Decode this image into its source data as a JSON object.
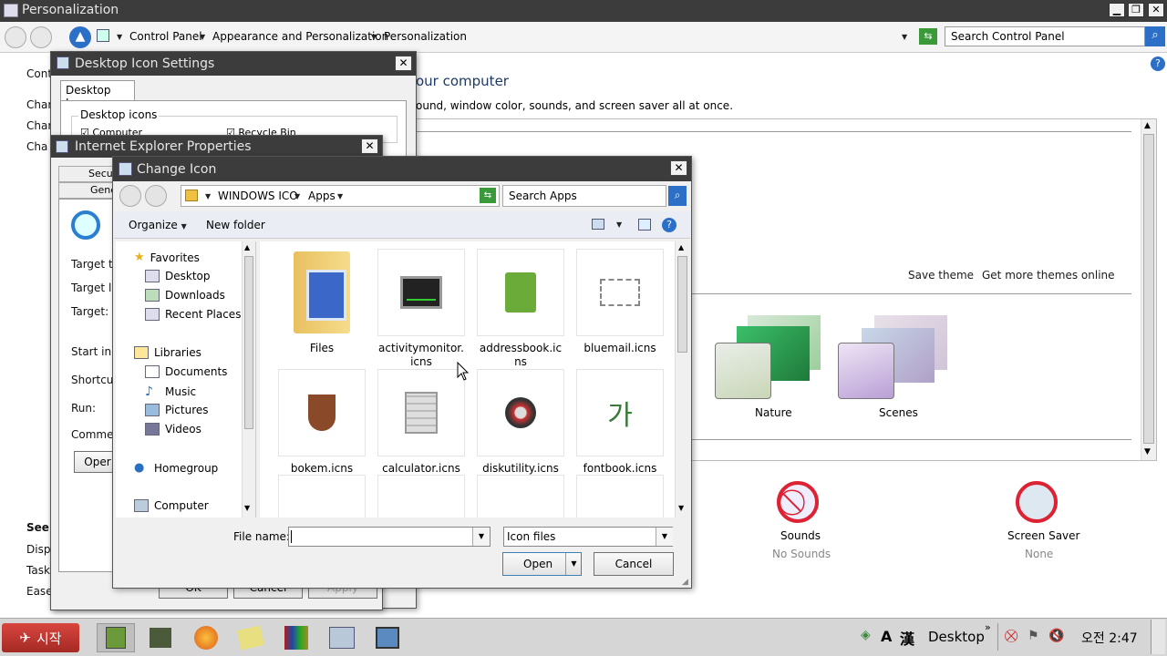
{
  "window": {
    "title": "Personalization",
    "minimize": "▁",
    "maximize": "❐",
    "close": "✕"
  },
  "addressbar": {
    "crumbs": [
      "Control Panel",
      "Appearance and Personalization",
      "Personalization"
    ],
    "search_placeholder": "Search Control Panel"
  },
  "sidebar": {
    "cont": "Cont",
    "items": [
      "Char",
      "Char",
      "Cha"
    ],
    "see_also": "See",
    "see_items": [
      "Disp",
      "Task",
      "Ease"
    ]
  },
  "main": {
    "heading": "our computer",
    "desc": "ound, window color, sounds, and screen saver all at once.",
    "save_theme": "Save theme",
    "get_more": "Get more themes online",
    "themes": [
      {
        "label": "Nature"
      },
      {
        "label": "Scenes"
      }
    ],
    "bottom": [
      {
        "label": "Sounds",
        "sub": "No Sounds"
      },
      {
        "label": "Screen Saver",
        "sub": "None"
      }
    ]
  },
  "desktop_icon_settings": {
    "title": "Desktop Icon Settings",
    "tab": "Desktop Icons",
    "group": "Desktop icons",
    "cb1": "Computer",
    "cb2": "Recycle Bin",
    "ok": "OK",
    "cancel": "Cancel",
    "apply": "Apply"
  },
  "ie_props": {
    "title": "Internet Explorer Properties",
    "tabs": [
      "Secur",
      "Gene"
    ],
    "fields": [
      "Target ty",
      "Target lc",
      "Target:",
      "Start in:",
      "Shortcut",
      "Run:",
      "Commer"
    ],
    "open_btn": "Oper"
  },
  "change_icon": {
    "title": "Change Icon",
    "path": [
      "WINDOWS ICO",
      "Apps"
    ],
    "search_placeholder": "Search Apps",
    "organize": "Organize",
    "new_folder": "New folder",
    "nav": {
      "favorites": "Favorites",
      "fav_items": [
        "Desktop",
        "Downloads",
        "Recent Places"
      ],
      "libraries": "Libraries",
      "lib_items": [
        "Documents",
        "Music",
        "Pictures",
        "Videos"
      ],
      "homegroup": "Homegroup",
      "computer": "Computer"
    },
    "files": [
      {
        "name": "Files",
        "icon": "folder-icon"
      },
      {
        "name": "activitymonitor.icns",
        "icon": "activity-monitor-icon"
      },
      {
        "name": "addressbook.icns",
        "icon": "address-book-icon"
      },
      {
        "name": "bluemail.icns",
        "icon": "mail-icon"
      },
      {
        "name": "bokem.icns",
        "icon": "shield-icon"
      },
      {
        "name": "calculator.icns",
        "icon": "calculator-icon"
      },
      {
        "name": "diskutility.icns",
        "icon": "disk-utility-icon"
      },
      {
        "name": "fontbook.icns",
        "icon": "font-book-icon"
      }
    ],
    "filename_label": "File name:",
    "filename_value": "",
    "filetype": "Icon files",
    "open": "Open",
    "cancel": "Cancel"
  },
  "taskbar": {
    "start": "시작",
    "lang1": "A",
    "lang2": "漢",
    "desktop": "Desktop",
    "clock": "오전 2:47"
  },
  "colors": {
    "titlebar": "#3c3c3c",
    "taskbar": "#d8d8d8",
    "start": "#c0302a"
  }
}
